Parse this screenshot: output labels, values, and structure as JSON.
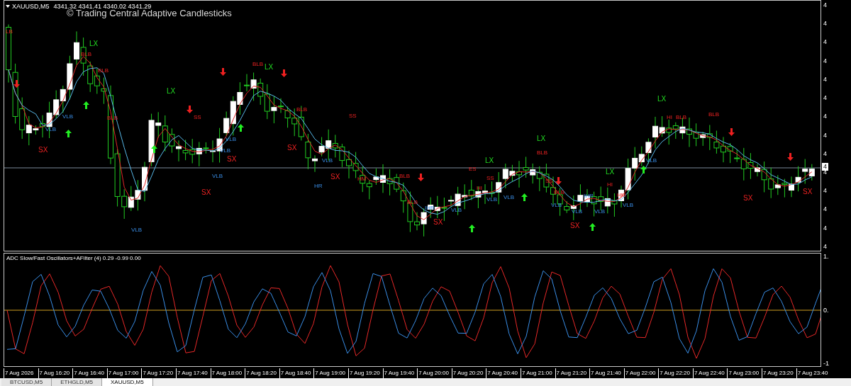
{
  "chart": {
    "symbol": "XAUUSD,M5",
    "quote": "4341.32 4341.41 4340.02 4341.29",
    "title": "© Trading Central Adaptive Candlesticks",
    "signals": [
      {
        "text": "LB",
        "kind": "mark"
      },
      {
        "text": "VLB",
        "kind": "band"
      },
      {
        "text": "SX",
        "kind": "exit"
      },
      {
        "text": "VLB",
        "kind": "band"
      },
      {
        "text": "LX",
        "kind": "long"
      },
      {
        "text": "BLB",
        "kind": "mark"
      },
      {
        "text": "BLB",
        "kind": "mark"
      },
      {
        "text": "BLB",
        "kind": "mark"
      },
      {
        "text": "VLB",
        "kind": "band"
      },
      {
        "text": "LX",
        "kind": "long"
      },
      {
        "text": "SS",
        "kind": "mark"
      },
      {
        "text": "SX",
        "kind": "exit"
      },
      {
        "text": "VLB",
        "kind": "band"
      },
      {
        "text": "VLB",
        "kind": "band"
      },
      {
        "text": "VLB",
        "kind": "band"
      },
      {
        "text": "SX",
        "kind": "exit"
      },
      {
        "text": "BLB",
        "kind": "mark"
      },
      {
        "text": "LX",
        "kind": "long"
      },
      {
        "text": "SX",
        "kind": "exit"
      },
      {
        "text": "BLB",
        "kind": "mark"
      },
      {
        "text": "HR",
        "kind": "band"
      },
      {
        "text": "VLB",
        "kind": "band"
      },
      {
        "text": "SX",
        "kind": "exit"
      },
      {
        "text": "SS",
        "kind": "mark"
      },
      {
        "text": "HM",
        "kind": "mark"
      },
      {
        "text": "BLB",
        "kind": "mark"
      },
      {
        "text": "BLB",
        "kind": "mark"
      },
      {
        "text": "IHR",
        "kind": "band"
      },
      {
        "text": "SX",
        "kind": "exit"
      },
      {
        "text": "VLB",
        "kind": "band"
      },
      {
        "text": "ES",
        "kind": "mark"
      },
      {
        "text": "HI",
        "kind": "mark"
      },
      {
        "text": "LX",
        "kind": "long"
      },
      {
        "text": "SS",
        "kind": "mark"
      },
      {
        "text": "VLB",
        "kind": "band"
      },
      {
        "text": "VLB",
        "kind": "band"
      },
      {
        "text": "LX",
        "kind": "long"
      },
      {
        "text": "BLB",
        "kind": "mark"
      },
      {
        "text": "SS",
        "kind": "mark"
      },
      {
        "text": "BLB",
        "kind": "mark"
      },
      {
        "text": "VLB",
        "kind": "band"
      },
      {
        "text": "VLB",
        "kind": "band"
      },
      {
        "text": "SX",
        "kind": "exit"
      },
      {
        "text": "IHR",
        "kind": "band"
      },
      {
        "text": "VLB",
        "kind": "band"
      },
      {
        "text": "LX",
        "kind": "long"
      },
      {
        "text": "HI",
        "kind": "mark"
      },
      {
        "text": "HM",
        "kind": "mark"
      },
      {
        "text": "VLB",
        "kind": "band"
      },
      {
        "text": "VLB",
        "kind": "band"
      },
      {
        "text": "LX",
        "kind": "long"
      },
      {
        "text": "HI",
        "kind": "mark"
      },
      {
        "text": "BLB",
        "kind": "mark"
      },
      {
        "text": "BLB",
        "kind": "mark"
      },
      {
        "text": "SX",
        "kind": "exit"
      },
      {
        "text": "SX",
        "kind": "exit"
      }
    ],
    "price_axis": [
      "4",
      "4",
      "4",
      "4",
      "4",
      "4",
      "4",
      "4",
      "4",
      "4",
      "4",
      "4",
      "4",
      "4"
    ],
    "current_price": "4"
  },
  "oscillator": {
    "title": "ADC Slow/Fast Oscillators+AFilter (4) 0.29 -0.99 0.00",
    "axis": [
      "1.",
      "0.",
      "-1"
    ]
  },
  "time_axis": [
    "7 Aug 2026",
    "7 Aug 16:20",
    "7 Aug 16:40",
    "7 Aug 17:00",
    "7 Aug 17:20",
    "7 Aug 17:40",
    "7 Aug 18:00",
    "7 Aug 18:20",
    "7 Aug 18:40",
    "7 Aug 19:00",
    "7 Aug 19:20",
    "7 Aug 19:40",
    "7 Aug 20:00",
    "7 Aug 20:20",
    "7 Aug 20:40",
    "7 Aug 21:00",
    "7 Aug 21:20",
    "7 Aug 21:40",
    "7 Aug 22:00",
    "7 Aug 22:20",
    "7 Aug 22:40",
    "7 Aug 23:00",
    "7 Aug 23:20",
    "7 Aug 23:40"
  ],
  "tabs": [
    {
      "label": "BTCUSD,M5",
      "selected": false
    },
    {
      "label": "ETHGLD,M5",
      "selected": false
    },
    {
      "label": "XAUUSD,M5",
      "selected": true
    }
  ]
}
